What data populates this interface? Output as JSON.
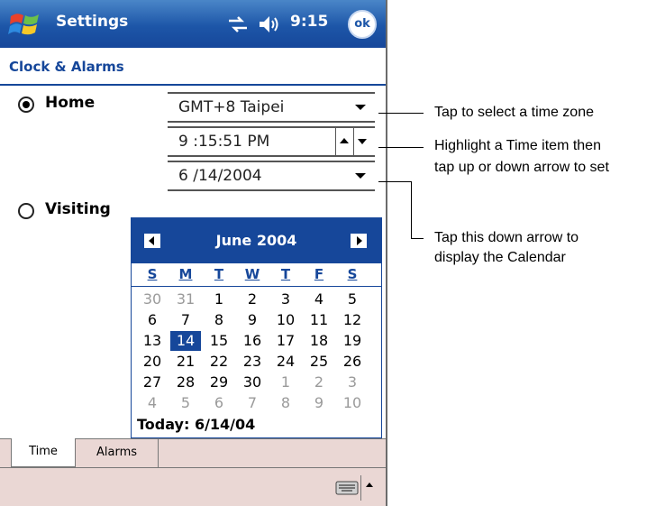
{
  "titlebar": {
    "title": "Settings",
    "clock": "9:15",
    "ok_label": "ok"
  },
  "page": {
    "title": "Clock & Alarms"
  },
  "home": {
    "label": "Home",
    "checked": true,
    "timezone": "GMT+8 Taipei",
    "time": "9 :15:51 PM",
    "date": "6 /14/2004"
  },
  "visiting": {
    "label": "Visiting",
    "checked": false
  },
  "calendar": {
    "month_label": "June 2004",
    "weekdays": [
      "S",
      "M",
      "T",
      "W",
      "T",
      "F",
      "S"
    ],
    "weeks": [
      [
        "30",
        "31",
        "1",
        "2",
        "3",
        "4",
        "5"
      ],
      [
        "6",
        "7",
        "8",
        "9",
        "10",
        "11",
        "12"
      ],
      [
        "13",
        "14",
        "15",
        "16",
        "17",
        "18",
        "19"
      ],
      [
        "20",
        "21",
        "22",
        "23",
        "24",
        "25",
        "26"
      ],
      [
        "27",
        "28",
        "29",
        "30",
        "1",
        "2",
        "3"
      ],
      [
        "4",
        "5",
        "6",
        "7",
        "8",
        "9",
        "10"
      ]
    ],
    "selected_day": "14",
    "today_label": "Today: 6/14/04"
  },
  "tabs": [
    {
      "label": "Time",
      "active": true
    },
    {
      "label": "Alarms",
      "active": false
    }
  ],
  "callouts": {
    "timezone": "Tap to select a time zone",
    "time_line1": "Highlight a Time item then",
    "time_line2": "tap up or down arrow to set",
    "calendar_line1": "Tap this down arrow to",
    "calendar_line2": "display the Calendar"
  },
  "colors": {
    "title_bar": "#16479a",
    "accent": "#16479a",
    "tab_bar": "#ead7d4",
    "other_month_day": "#9a9a9a"
  },
  "icons": [
    "windows-start-icon",
    "connectivity-icon",
    "speaker-icon",
    "ok-button",
    "keyboard-icon"
  ]
}
